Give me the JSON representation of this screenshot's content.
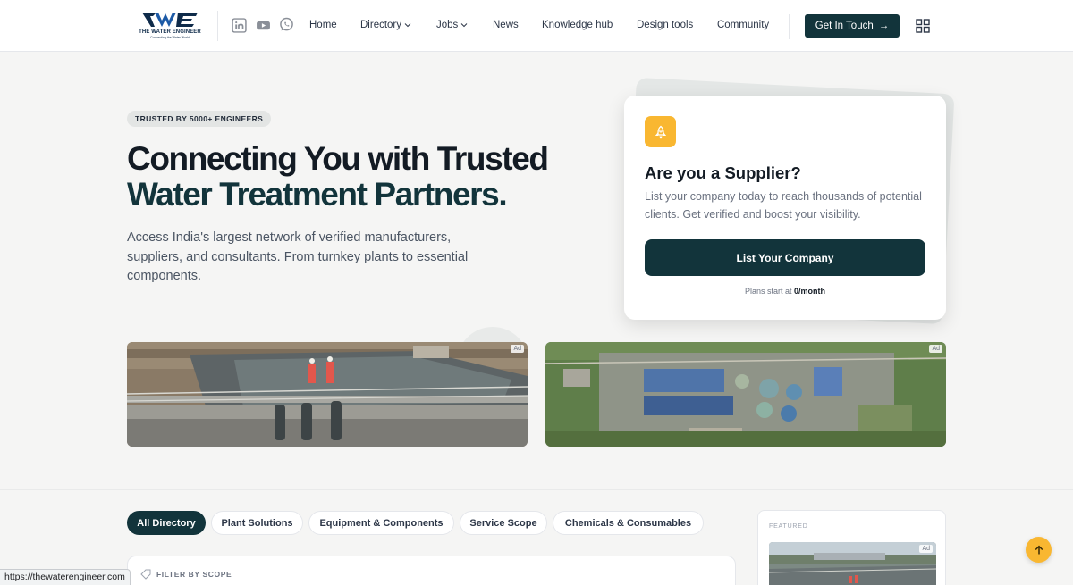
{
  "header": {
    "logo_text": "THE WATER ENGINEER",
    "logo_tagline": "Connecting the Water World",
    "social": [
      "linkedin-icon",
      "youtube-icon",
      "whatsapp-icon"
    ],
    "nav": [
      {
        "label": "Home",
        "has_dropdown": false
      },
      {
        "label": "Directory",
        "has_dropdown": true
      },
      {
        "label": "Jobs",
        "has_dropdown": true
      },
      {
        "label": "News",
        "has_dropdown": false
      },
      {
        "label": "Knowledge hub",
        "has_dropdown": false
      },
      {
        "label": "Design tools",
        "has_dropdown": false
      },
      {
        "label": "Community",
        "has_dropdown": false
      }
    ],
    "cta_label": "Get In Touch",
    "cta_arrow": "→"
  },
  "hero": {
    "badge": "TRUSTED BY 5000+ ENGINEERS",
    "title_line1": "Connecting You with Trusted",
    "title_line2": "Water Treatment Partners.",
    "description": "Access India's largest network of verified manufacturers, suppliers, and consultants. From turnkey plants to essential components."
  },
  "supplier_card": {
    "title": "Are you a Supplier?",
    "description": "List your company today to reach thousands of potential clients. Get verified and boost your visibility.",
    "button_label": "List Your Company",
    "plans_prefix": "Plans start at ",
    "plans_price": "0/month"
  },
  "ads": {
    "label": "Ad"
  },
  "directory": {
    "chips": [
      {
        "label": "All Directory",
        "active": true
      },
      {
        "label": "Plant Solutions",
        "active": false
      },
      {
        "label": "Equipment & Components",
        "active": false
      },
      {
        "label": "Service Scope",
        "active": false
      },
      {
        "label": "Chemicals & Consumables",
        "active": false
      }
    ],
    "filter_label": "FILTER BY SCOPE"
  },
  "featured": {
    "label": "FEATURED",
    "ad_label": "Ad"
  },
  "status_bar": {
    "url": "https://thewaterengineer.com"
  },
  "colors": {
    "primary": "#12343b",
    "accent": "#f9b731",
    "background": "#f5f5f4"
  }
}
